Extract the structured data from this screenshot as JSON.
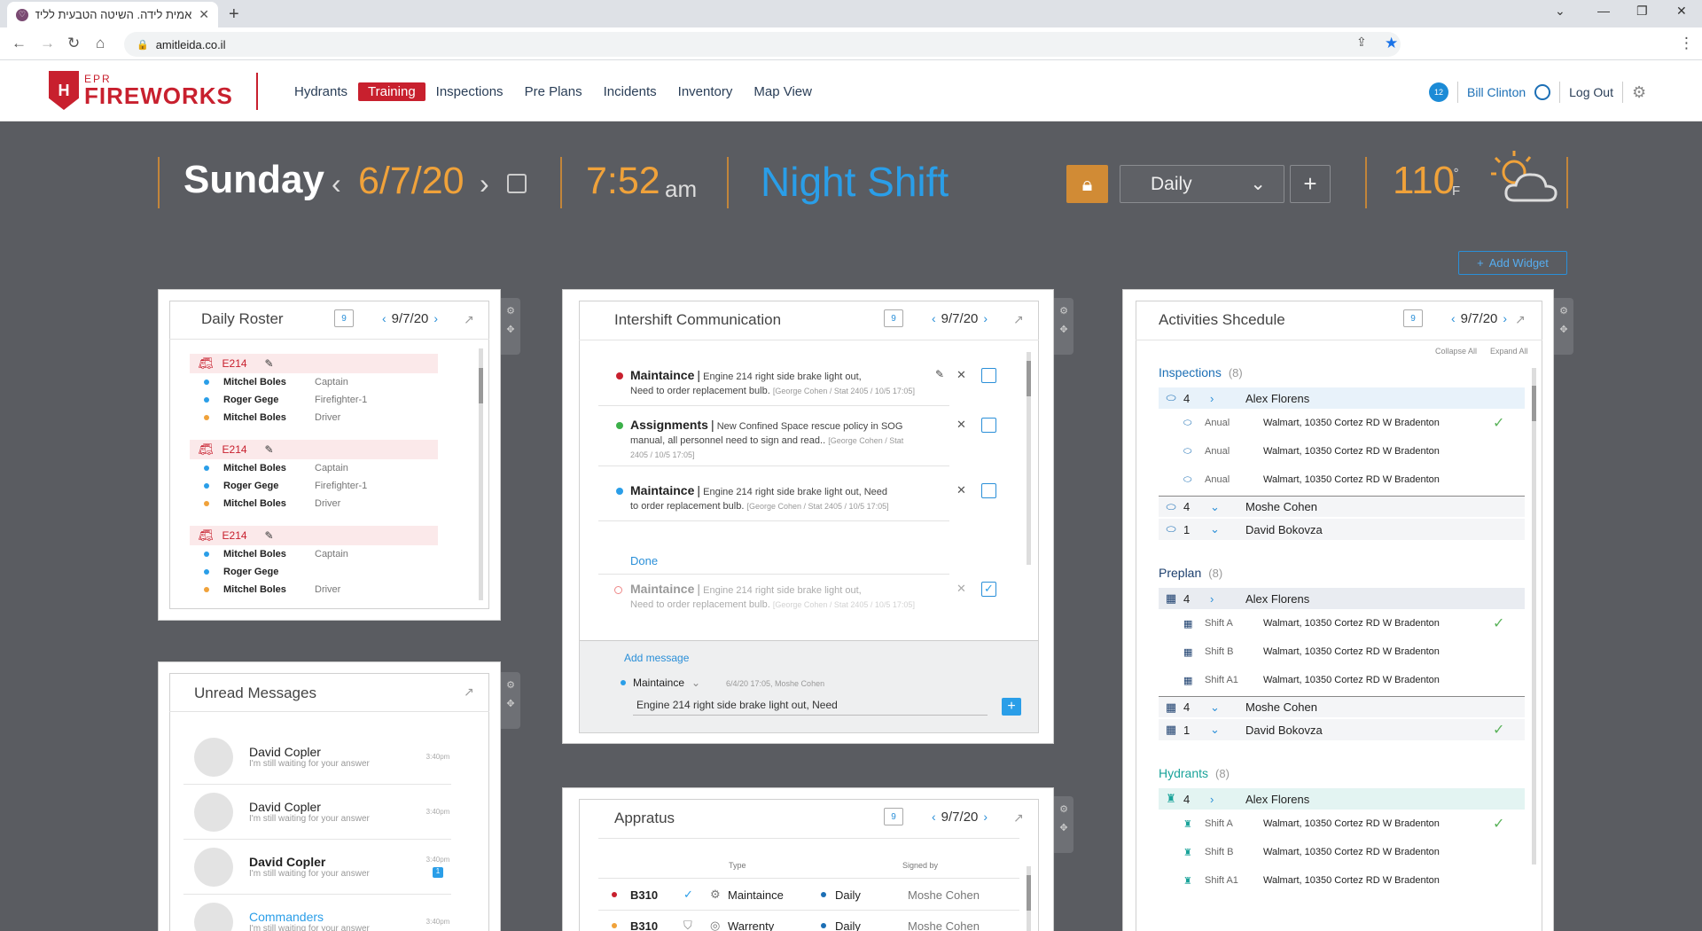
{
  "browser": {
    "tab_title": "אמית לידה. השיטה הטבעית ללידה",
    "url": "amitleida.co.il"
  },
  "header": {
    "logo_top": "EPR",
    "logo_main": "FIREWORKS",
    "nav": [
      "Hydrants",
      "Training",
      "Inspections",
      "Pre Plans",
      "Incidents",
      "Inventory",
      "Map View"
    ],
    "active_nav": "Training",
    "notifications": "12",
    "user": "Bill Clinton",
    "logout": "Log Out"
  },
  "topbar": {
    "day": "Sunday",
    "date": "6/7/20",
    "time": "7:52",
    "ampm": "am",
    "shift": "Night Shift",
    "view": "Daily",
    "temp": "110",
    "temp_deg": "°",
    "temp_unit": "F",
    "add_widget": "Add Widget"
  },
  "roster": {
    "title": "Daily Roster",
    "cal_day": "9",
    "date": "9/7/20",
    "groups": [
      {
        "unit": "E214",
        "members": [
          {
            "name": "Mitchel Boles",
            "role": "Captain",
            "color": "#2a9ee8"
          },
          {
            "name": "Roger Gege",
            "role": "Firefighter-1",
            "color": "#2a9ee8"
          },
          {
            "name": "Mitchel Boles",
            "role": "Driver",
            "color": "#f0a23a"
          }
        ]
      },
      {
        "unit": "E214",
        "members": [
          {
            "name": "Mitchel Boles",
            "role": "Captain",
            "color": "#2a9ee8"
          },
          {
            "name": "Roger Gege",
            "role": "Firefighter-1",
            "color": "#2a9ee8"
          },
          {
            "name": "Mitchel Boles",
            "role": "Driver",
            "color": "#f0a23a"
          }
        ]
      },
      {
        "unit": "E214",
        "members": [
          {
            "name": "Mitchel Boles",
            "role": "Captain",
            "color": "#2a9ee8"
          },
          {
            "name": "Roger Gege",
            "role": "",
            "color": "#2a9ee8"
          },
          {
            "name": "Mitchel Boles",
            "role": "Driver",
            "color": "#f0a23a"
          }
        ]
      }
    ]
  },
  "messages": {
    "title": "Unread Messages",
    "items": [
      {
        "name": "David Copler",
        "text": "I'm still waiting for your answer",
        "time": "3:40pm",
        "bold": false,
        "badge": ""
      },
      {
        "name": "David Copler",
        "text": "I'm still waiting for your answer",
        "time": "3:40pm",
        "bold": false,
        "badge": ""
      },
      {
        "name": "David Copler",
        "text": "I'm still waiting for your answer",
        "time": "3:40pm",
        "bold": true,
        "badge": "1"
      },
      {
        "name": "Commanders",
        "text": "I'm still waiting for your answer",
        "time": "3:40pm",
        "bold": false,
        "badge": ""
      }
    ]
  },
  "intershift": {
    "title": "Intershift Communication",
    "cal_day": "9",
    "date": "9/7/20",
    "items": [
      {
        "cat": "Maintaince",
        "sep": "|",
        "text": "Engine 214 right side brake light out,",
        "text2": "Need to order replacement bulb.",
        "meta": "[George Cohen / Stat 2405 / 10/5 17:05]",
        "dot": "#c8202e"
      },
      {
        "cat": "Assignments",
        "sep": "|",
        "text": "New Confined Space rescue policy in SOG",
        "text2": "manual,  all personnel need to sign and read..",
        "meta": "[George Cohen / Stat",
        "meta2": "2405 / 10/5 17:05]",
        "dot": "#3cb04a"
      },
      {
        "cat": "Maintaince",
        "sep": "|",
        "text": "Engine 214 right side brake light out, Need",
        "text2": "to order replacement bulb.",
        "meta": "[George Cohen / Stat 2405 / 10/5 17:05]",
        "dot": "#2a9ee8"
      }
    ],
    "done_label": "Done",
    "done_item": {
      "cat": "Maintaince",
      "sep": "|",
      "text": "Engine 214 right side brake light out,",
      "text2": "Need to order replacement bulb.",
      "meta": "[George Cohen / Stat 2405 / 10/5 17:05]"
    },
    "add_message": "Add message",
    "compose_cat": "Maintaince",
    "compose_meta": "6/4/20 17:05, Moshe Cohen",
    "compose_text": "Engine 214 right side brake light out, Need"
  },
  "apparatus": {
    "title": "Appratus",
    "cal_day": "9",
    "date": "9/7/20",
    "col_type": "Type",
    "col_signed": "Signed by",
    "rows": [
      {
        "id": "B310",
        "type": "Maintaince",
        "freq": "Daily",
        "signer": "Moshe Cohen",
        "dot": "#c8202e"
      },
      {
        "id": "B310",
        "type": "Warrenty",
        "freq": "Daily",
        "signer": "Moshe Cohen",
        "dot": "#f0a23a"
      }
    ]
  },
  "activities": {
    "title": "Activities Shcedule",
    "cal_day": "9",
    "date": "9/7/20",
    "collapse_all": "Collapse All",
    "expand_all": "Expand All",
    "sections": [
      {
        "name": "Inspections",
        "count": "(8)",
        "groups": [
          {
            "n": "4",
            "person": "Alex Florens",
            "open": true,
            "rows": [
              {
                "label": "Anual",
                "addr": "Walmart, 10350 Cortez RD W Bradenton",
                "done": true
              },
              {
                "label": "Anual",
                "addr": "Walmart, 10350 Cortez RD W Bradenton",
                "done": false
              },
              {
                "label": "Anual",
                "addr": "Walmart, 10350 Cortez RD W Bradenton",
                "done": false
              }
            ]
          },
          {
            "n": "4",
            "person": "Moshe Cohen",
            "open": false,
            "done": false
          },
          {
            "n": "1",
            "person": "David Bokovza",
            "open": false,
            "done": false
          }
        ]
      },
      {
        "name": "Preplan",
        "count": "(8)",
        "groups": [
          {
            "n": "4",
            "person": "Alex Florens",
            "open": true,
            "rows": [
              {
                "label": "Shift A",
                "addr": "Walmart, 10350 Cortez RD W Bradenton",
                "done": true
              },
              {
                "label": "Shift B",
                "addr": "Walmart, 10350 Cortez RD W Bradenton",
                "done": false
              },
              {
                "label": "Shift A1",
                "addr": "Walmart, 10350 Cortez RD W Bradenton",
                "done": false
              }
            ]
          },
          {
            "n": "4",
            "person": "Moshe Cohen",
            "open": false,
            "done": false
          },
          {
            "n": "1",
            "person": "David Bokovza",
            "open": false,
            "done": true
          }
        ]
      },
      {
        "name": "Hydrants",
        "count": "(8)",
        "groups": [
          {
            "n": "4",
            "person": "Alex Florens",
            "open": true,
            "rows": [
              {
                "label": "Shift A",
                "addr": "Walmart, 10350 Cortez RD W Bradenton",
                "done": true
              },
              {
                "label": "Shift B",
                "addr": "Walmart, 10350 Cortez RD W Bradenton",
                "done": false
              },
              {
                "label": "Shift A1",
                "addr": "Walmart, 10350 Cortez RD W Bradenton",
                "done": false
              }
            ]
          }
        ]
      }
    ]
  }
}
